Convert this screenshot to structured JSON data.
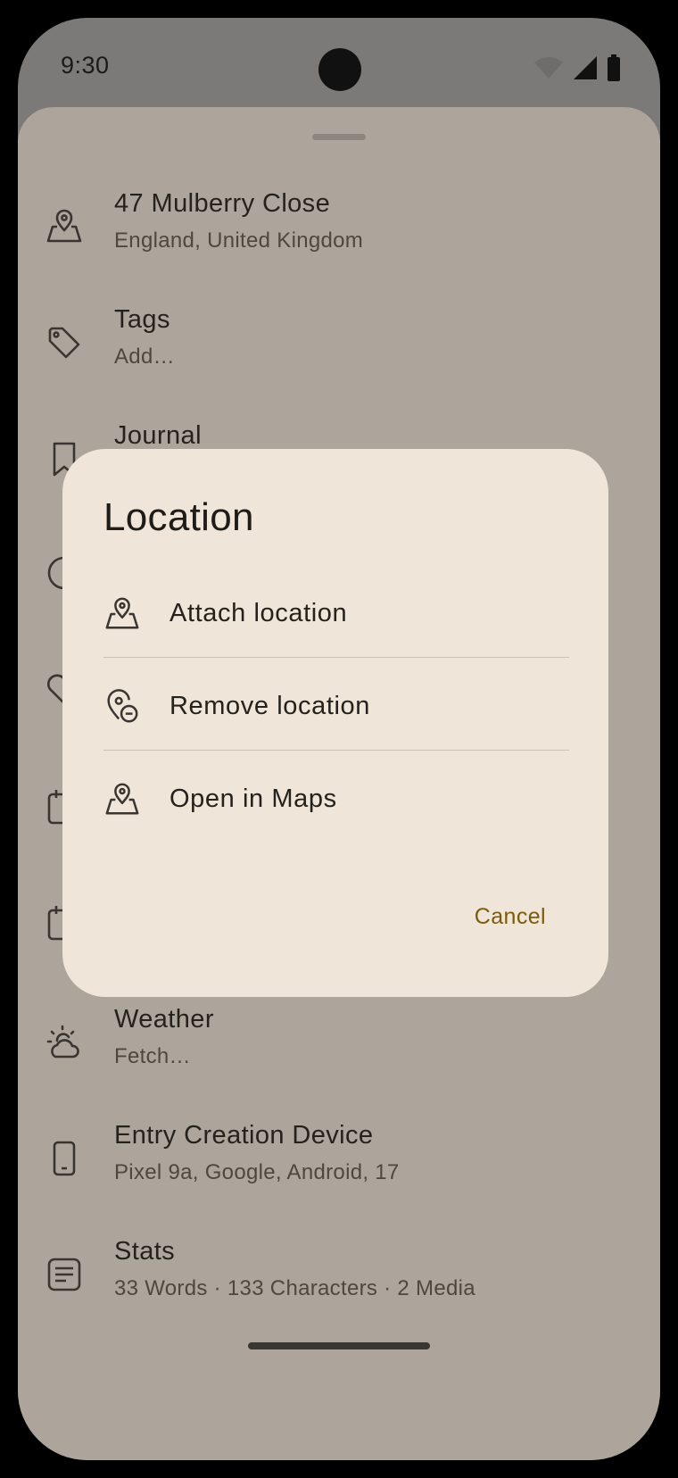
{
  "status_bar": {
    "time": "9:30",
    "icons": [
      "wifi-icon",
      "signal-icon",
      "battery-icon"
    ]
  },
  "rows": [
    {
      "icon": "location-pin-icon",
      "title": "47 Mulberry Close",
      "subtitle": "England, United Kingdom"
    },
    {
      "icon": "tag-icon",
      "title": "Tags",
      "subtitle": "Add…"
    },
    {
      "icon": "bookmark-icon",
      "title": "Journal",
      "subtitle": ""
    },
    {
      "icon": "weather-icon",
      "title": "Weather",
      "subtitle": "Fetch…"
    },
    {
      "icon": "phone-device-icon",
      "title": "Entry Creation Device",
      "subtitle": "Pixel 9a, Google, Android, 17"
    },
    {
      "icon": "stats-icon",
      "title": "Stats",
      "subtitle": "33 Words · 133 Characters · 2 Media"
    }
  ],
  "dialog": {
    "title": "Location",
    "options": [
      {
        "icon": "location-pin-icon",
        "label": "Attach location"
      },
      {
        "icon": "location-remove-icon",
        "label": "Remove location"
      },
      {
        "icon": "location-pin-icon",
        "label": "Open in Maps"
      }
    ],
    "cancel_label": "Cancel"
  },
  "colors": {
    "sheet_scrim": "#ada59b",
    "dialog_bg": "#efe5d9",
    "accent": "#7a5c0a",
    "text": "#25211c"
  }
}
